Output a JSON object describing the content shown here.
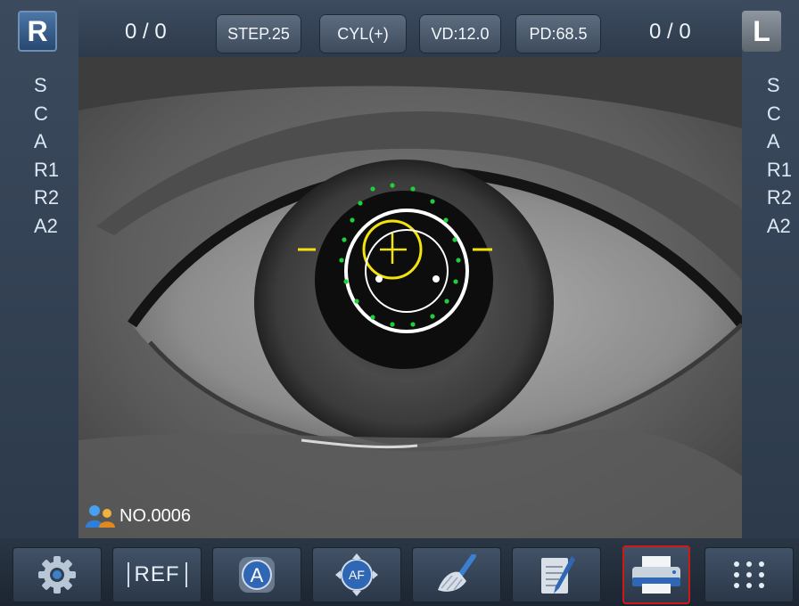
{
  "left_eye_panel": {
    "eye_label": "R",
    "params": [
      "S",
      "C",
      "A",
      "R1",
      "R2",
      "A2"
    ]
  },
  "right_eye_panel": {
    "eye_label": "L",
    "params": [
      "S",
      "C",
      "A",
      "R1",
      "R2",
      "A2"
    ]
  },
  "top_bar": {
    "left_count": "0 / 0",
    "right_count": "0 / 0",
    "step": "STEP.25",
    "cyl": "CYL(+)",
    "vd": "VD:12.0",
    "pd": "PD:68.5"
  },
  "patient": {
    "number": "NO.0006",
    "icon": "patients-icon"
  },
  "toolbar": {
    "buttons": [
      {
        "name": "settings",
        "icon": "gear-icon"
      },
      {
        "name": "ref",
        "label": "REF"
      },
      {
        "name": "auto",
        "label": "A",
        "icon": "auto-icon"
      },
      {
        "name": "af",
        "label": "AF",
        "icon": "autofocus-icon"
      },
      {
        "name": "clear",
        "icon": "brush-icon"
      },
      {
        "name": "notes",
        "icon": "notepad-icon"
      },
      {
        "name": "print",
        "icon": "printer-icon",
        "selected": true
      },
      {
        "name": "menu",
        "icon": "grid-dots-icon"
      }
    ]
  },
  "colors": {
    "accent_yellow": "#f2e20e",
    "alignment_green": "#1fcf3a",
    "selection_red": "#d01818"
  }
}
